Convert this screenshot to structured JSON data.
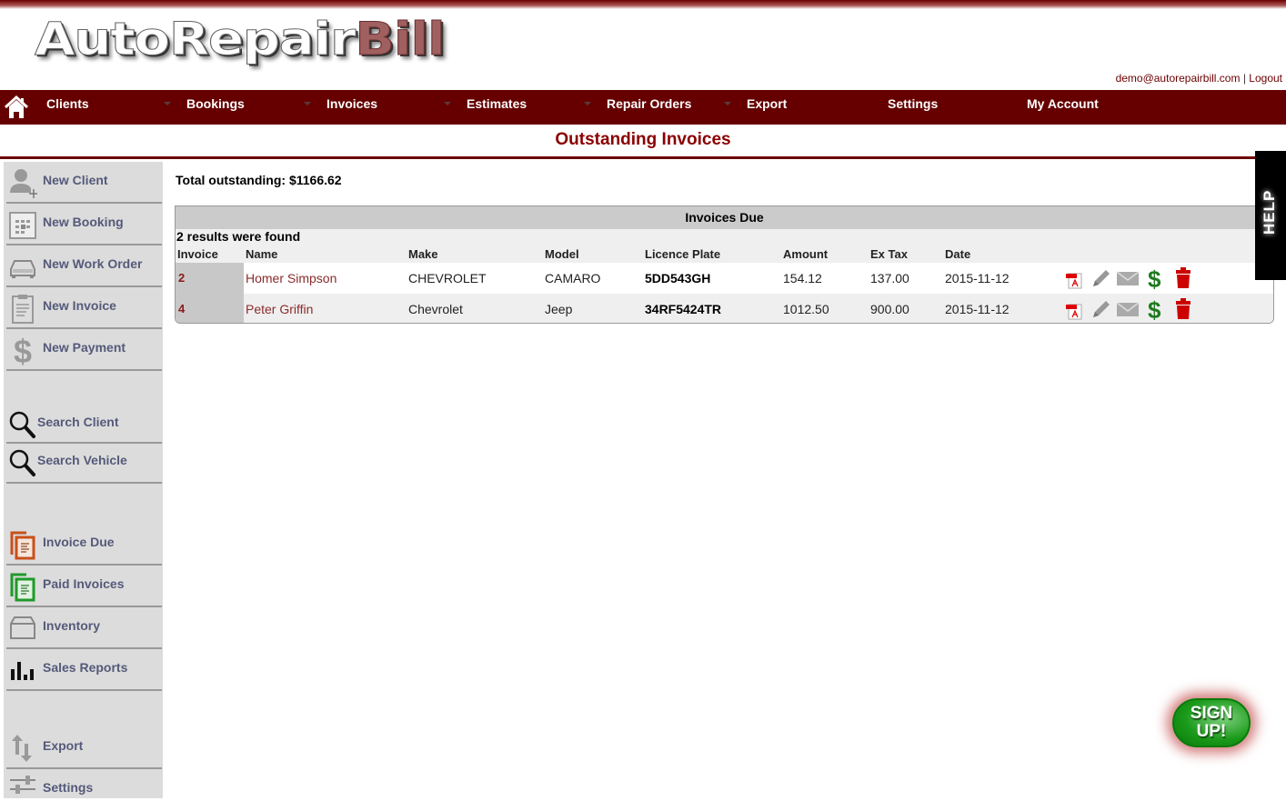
{
  "app": {
    "logo_part1": "AutoRepair",
    "logo_part2": "Bill"
  },
  "user": {
    "email": "demo@autorepairbill.com",
    "separator": "|",
    "logout": "Logout"
  },
  "nav": {
    "items": [
      {
        "label": "Clients",
        "has_dropdown": true
      },
      {
        "label": "Bookings",
        "has_dropdown": true
      },
      {
        "label": "Invoices",
        "has_dropdown": true
      },
      {
        "label": "Estimates",
        "has_dropdown": true
      },
      {
        "label": "Repair Orders",
        "has_dropdown": true
      },
      {
        "label": "Export",
        "has_dropdown": false
      },
      {
        "label": "Settings",
        "has_dropdown": false
      },
      {
        "label": "My Account",
        "has_dropdown": false
      }
    ]
  },
  "page": {
    "title": "Outstanding Invoices",
    "total_label": "Total outstanding: $1166.62"
  },
  "sidebar": {
    "items": [
      {
        "label": "New Client",
        "icon": "add-user-icon"
      },
      {
        "label": "New Booking",
        "icon": "calendar-icon"
      },
      {
        "label": "New Work Order",
        "icon": "car-icon"
      },
      {
        "label": "New Invoice",
        "icon": "clipboard-icon"
      },
      {
        "label": "New Payment",
        "icon": "dollar-icon"
      },
      {
        "label": "Search Client",
        "icon": "search-icon"
      },
      {
        "label": "Search Vehicle",
        "icon": "search-icon"
      },
      {
        "label": "Invoice Due",
        "icon": "invoice-due-icon"
      },
      {
        "label": "Paid Invoices",
        "icon": "paid-invoices-icon"
      },
      {
        "label": "Inventory",
        "icon": "box-icon"
      },
      {
        "label": "Sales Reports",
        "icon": "bar-chart-icon"
      },
      {
        "label": "Export",
        "icon": "export-arrows-icon"
      },
      {
        "label": "Settings",
        "icon": "sliders-icon"
      }
    ]
  },
  "table": {
    "title": "Invoices Due",
    "results_text": "2 results were found",
    "columns": [
      "Invoice",
      "Name",
      "Make",
      "Model",
      "Licence Plate",
      "Amount",
      "Ex Tax",
      "Date"
    ],
    "rows": [
      {
        "invoice": "2",
        "name": "Homer Simpson",
        "make": "CHEVROLET",
        "model": "CAMARO",
        "plate": "5DD543GH",
        "amount": "154.12",
        "ex_tax": "137.00",
        "date": "2015-11-12"
      },
      {
        "invoice": "4",
        "name": "Peter Griffin",
        "make": "Chevrolet",
        "model": "Jeep",
        "plate": "34RF5424TR",
        "amount": "1012.50",
        "ex_tax": "900.00",
        "date": "2015-11-12"
      }
    ],
    "actions": [
      "pdf-icon",
      "edit-pencil-icon",
      "email-icon",
      "payment-dollar-icon",
      "delete-trash-icon"
    ]
  },
  "help": {
    "label": "HELP"
  },
  "signup": {
    "line1": "SIGN",
    "line2": "UP!"
  },
  "colors": {
    "brand": "#660000",
    "title": "#8b0000",
    "link": "#8b2b2b",
    "sidebar_bg": "#dcdcdc",
    "sidebar_text": "#555a7a",
    "signup_green": "#1a9a1a",
    "delete_red": "#cc0000",
    "dollar_green": "#1f7a1f"
  }
}
